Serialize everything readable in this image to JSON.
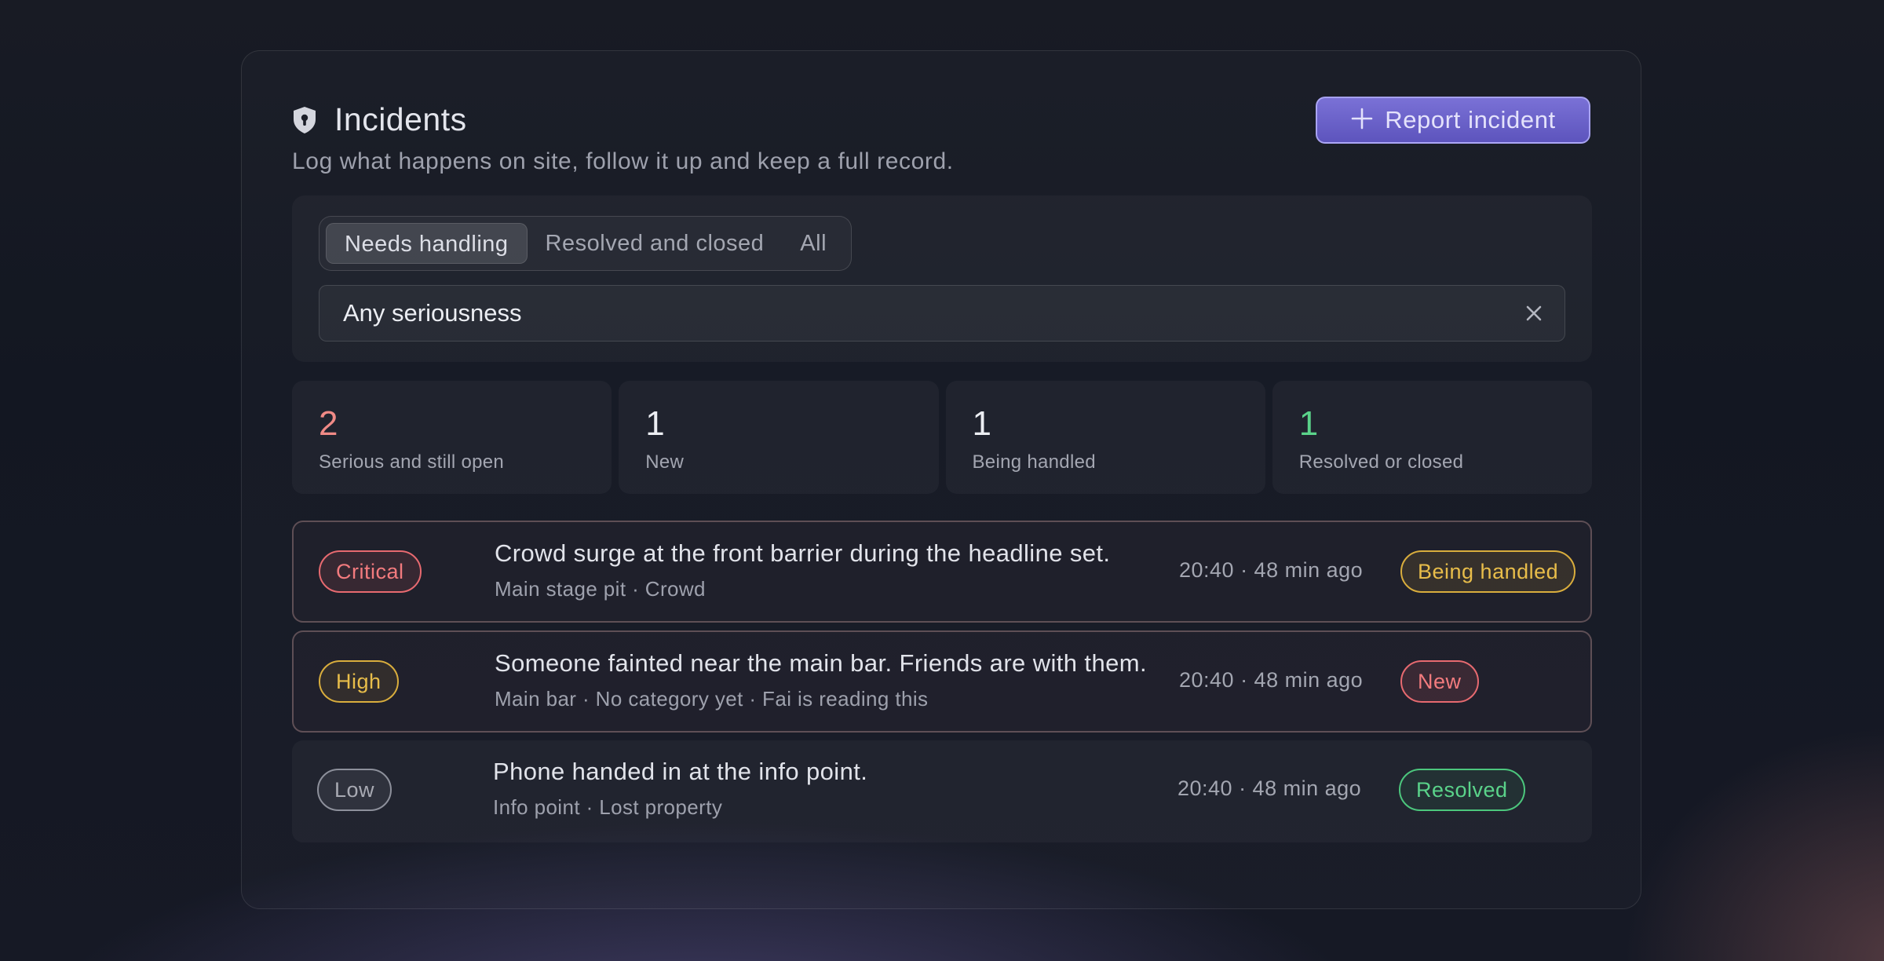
{
  "header": {
    "title": "Incidents",
    "subtitle": "Log what happens on site, follow it up and keep a full record.",
    "report_button": "Report incident"
  },
  "filters": {
    "tabs": [
      "Needs handling",
      "Resolved and closed",
      "All"
    ],
    "active_tab": "Needs handling",
    "seriousness_select": "Any seriousness"
  },
  "stats": [
    {
      "value": "2",
      "label": "Serious and still open",
      "color": "#f08a86"
    },
    {
      "value": "1",
      "label": "New",
      "color": "#eceef3"
    },
    {
      "value": "1",
      "label": "Being handled",
      "color": "#eceef3"
    },
    {
      "value": "1",
      "label": "Resolved or closed",
      "color": "#5ad38a"
    }
  ],
  "incidents": [
    {
      "severity": "Critical",
      "title": "Crowd surge at the front barrier during the headline set.",
      "meta": "Main stage pit · Crowd",
      "time": "20:40 · 48 min ago",
      "status": "Being handled"
    },
    {
      "severity": "High",
      "title": "Someone fainted near the main bar. Friends are with them.",
      "meta": "Main bar · No category yet · Fai is reading this",
      "time": "20:40 · 48 min ago",
      "status": "New"
    },
    {
      "severity": "Low",
      "title": "Phone handed in at the info point.",
      "meta": "Info point · Lost property",
      "time": "20:40 · 48 min ago",
      "status": "Resolved"
    }
  ],
  "colors": {
    "accent": "#6a61cc",
    "critical": "#e76a70",
    "high": "#d9ad3d",
    "low": "#8d909b",
    "resolved": "#4cc77d"
  },
  "icons": {
    "title_icon": "shield-icon",
    "report_icon": "plus-icon",
    "clear_icon": "close-icon"
  }
}
